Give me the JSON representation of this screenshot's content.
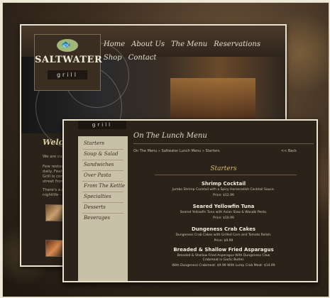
{
  "background": {
    "color": "#3b2d20"
  },
  "back_window": {
    "logo": {
      "name": "SALTWATER",
      "sub": "grill"
    },
    "nav": [
      "Home",
      "About Us",
      "The Menu",
      "Reservations",
      "Shop",
      "Contact"
    ],
    "welcome": "Welco",
    "para1": "We are curren",
    "para2": "Few restaurant",
    "para3": "daily. Featurin",
    "para4": "Grill is conveni",
    "para5": "street from the",
    "para6": "There's a reaso",
    "para7": "nightlife - and"
  },
  "front_window": {
    "tab_label": "grill",
    "sidebar": [
      "Starters",
      "Soup & Salad",
      "Sandwiches",
      "Over Pasta",
      "From The Kettle",
      "Specialties",
      "Desserts",
      "Beverages"
    ],
    "page_title": "On The Lunch Menu",
    "breadcrumb": "On The Menu » Saltwater Lunch Menu » Starters",
    "back_link": "<< Back",
    "section_title": "Starters",
    "dishes": [
      {
        "name": "Shrimp Cocktail",
        "desc": "Jumbo Shrimp Cocktail with a Spicy Horseradish Cocktail Sauce.",
        "price": "Price: $12.99"
      },
      {
        "name": "Seared Yellowfin Tuna",
        "desc": "Seared Yellowfin Tuna with Asian Slaw & Wasabi Pesto.",
        "price": "Price: $10.99"
      },
      {
        "name": "Dungeness Crab Cakes",
        "desc": "Dungeness Crab Cakes with Grilled Corn and Tomato Relish.",
        "price": "Price: $9.99"
      },
      {
        "name": "Breaded & Shallow Fried Asparagus",
        "desc": "Breaded & Shallow Fried Asparagus With Dungeness Claw Crabmeat in Garlic Butter.",
        "price": "With Dungeness Crabmeat: $9.99   With Lump Crab Meat: $14.99"
      }
    ]
  }
}
